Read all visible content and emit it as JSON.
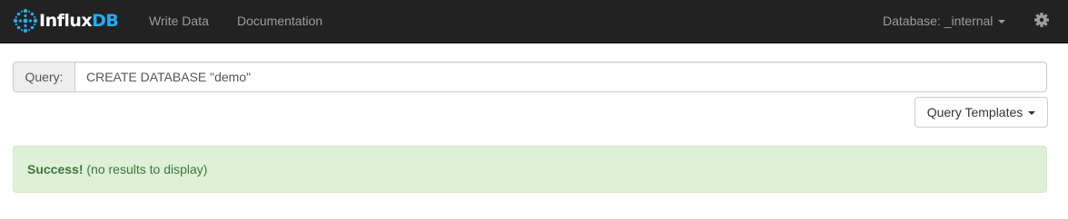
{
  "navbar": {
    "brand": {
      "text_light": "Influx",
      "text_accent": "DB"
    },
    "links": [
      {
        "label": "Write Data"
      },
      {
        "label": "Documentation"
      }
    ],
    "database_label": "Database: _internal",
    "settings_icon": "gear-icon",
    "colors": {
      "background": "#222222",
      "link": "#9d9d9d",
      "accent": "#22adf6"
    }
  },
  "query": {
    "addon_label": "Query:",
    "value": "CREATE DATABASE \"demo\""
  },
  "templates_button": {
    "label": "Query Templates"
  },
  "alert": {
    "title": "Success!",
    "message": " (no results to display)",
    "colors": {
      "background": "#dff0d8",
      "text": "#3c763d"
    }
  }
}
